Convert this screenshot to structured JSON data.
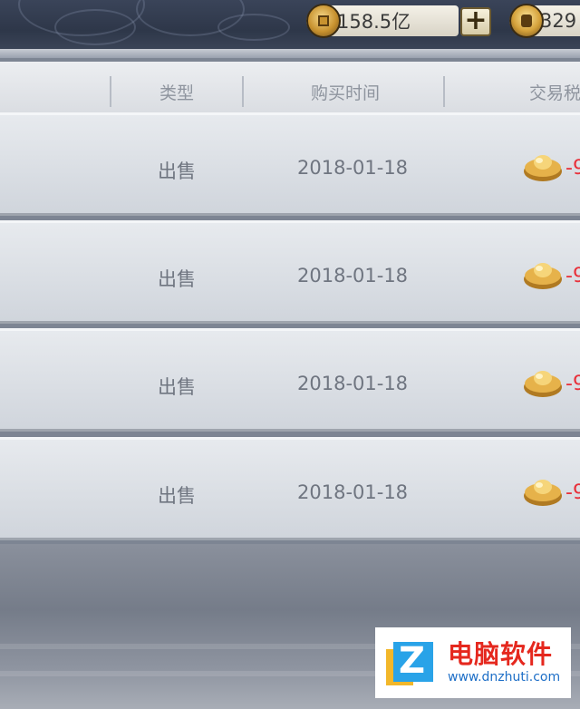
{
  "currencies": {
    "coin_amount": "158.5亿",
    "ingot_amount": "329"
  },
  "table": {
    "headers": [
      "类型",
      "购买时间",
      "交易税"
    ],
    "rows": [
      {
        "type": "出售",
        "date": "2018-01-18",
        "tax": "-9"
      },
      {
        "type": "出售",
        "date": "2018-01-18",
        "tax": "-9"
      },
      {
        "type": "出售",
        "date": "2018-01-18",
        "tax": "-9"
      },
      {
        "type": "出售",
        "date": "2018-01-18",
        "tax": "-9"
      }
    ]
  },
  "watermark": {
    "title": "电脑软件",
    "url": "www.dnzhuti.com"
  },
  "colors": {
    "tax_negative": "#e8303a",
    "text_gray": "#6f7580"
  },
  "icons": [
    "copper-coin-icon",
    "gold-ingot-icon",
    "plus-icon",
    "yuanbao-icon"
  ]
}
